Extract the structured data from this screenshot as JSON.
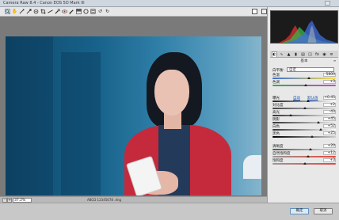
{
  "window": {
    "title": "Camera Raw 8.4 - Canon EOS 5D Mark III"
  },
  "toolbar": {
    "tools": [
      "zoom-icon",
      "hand-icon",
      "white-balance-icon",
      "color-sampler-icon",
      "target-adjust-icon",
      "crop-icon",
      "straighten-icon",
      "spot-removal-icon",
      "red-eye-icon",
      "adjustment-brush-icon",
      "graduated-filter-icon",
      "radial-filter-icon",
      "preferences-icon",
      "rotate-ccw-icon",
      "rotate-cw-icon"
    ]
  },
  "statusbar": {
    "zoom_value": "37.2%",
    "file_info": "ABCD 12345678 .dng"
  },
  "histogram": {
    "readout": ""
  },
  "panel": {
    "section_title": "基本",
    "white_balance": {
      "label": "白平衡:",
      "value": "自定"
    },
    "links": {
      "auto": "自动",
      "default": "默认值"
    },
    "sliders": [
      {
        "label": "色温",
        "value": "5800",
        "pos": 0.58,
        "gradient": "linear-gradient(90deg,#3a6fd6,#ffe04a)"
      },
      {
        "label": "色调",
        "value": "+3",
        "pos": 0.52,
        "gradient": "linear-gradient(90deg,#2fb14a,#d23fd2)"
      },
      {
        "label": "曝光",
        "value": "+0.45",
        "pos": 0.56,
        "gradient": "linear-gradient(90deg,#222,#fff)"
      },
      {
        "label": "对比度",
        "value": "+2",
        "pos": 0.51,
        "gradient": "linear-gradient(90deg,#444,#ddd)"
      },
      {
        "label": "高光",
        "value": "-43",
        "pos": 0.29,
        "gradient": "linear-gradient(90deg,#333,#eee)"
      },
      {
        "label": "阴影",
        "value": "+45",
        "pos": 0.72,
        "gradient": "linear-gradient(90deg,#333,#eee)"
      },
      {
        "label": "白色",
        "value": "+52",
        "pos": 0.76,
        "gradient": "linear-gradient(90deg,#333,#fff)"
      },
      {
        "label": "黑色",
        "value": "+25",
        "pos": 0.62,
        "gradient": "linear-gradient(90deg,#000,#ccc)"
      },
      {
        "label": "清晰度",
        "value": "+20",
        "pos": 0.6,
        "gradient": "linear-gradient(90deg,#555,#ddd)"
      },
      {
        "label": "自然饱和度",
        "value": "+12",
        "pos": 0.56,
        "gradient": "linear-gradient(90deg,#999,#e8473b)"
      },
      {
        "label": "饱和度",
        "value": "+3",
        "pos": 0.51,
        "gradient": "linear-gradient(90deg,#999,#e8473b)"
      }
    ]
  },
  "buttons": {
    "ok": "确定",
    "cancel": "取消"
  }
}
